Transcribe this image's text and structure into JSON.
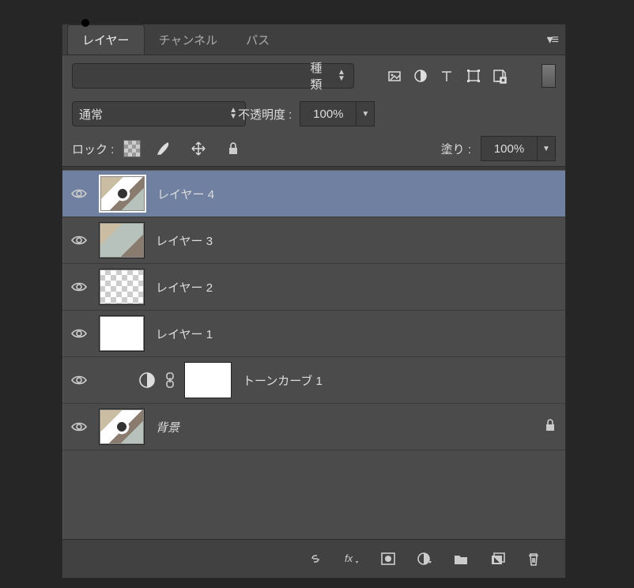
{
  "tabs": {
    "layers": "レイヤー",
    "channels": "チャンネル",
    "paths": "パス"
  },
  "filter": {
    "kind": "種類"
  },
  "blend": {
    "mode": "通常",
    "opacity_label": "不透明度 :",
    "opacity": "100%"
  },
  "lock": {
    "label": "ロック :",
    "fill_label": "塗り :",
    "fill": "100%"
  },
  "layers": [
    {
      "name": "レイヤー 4"
    },
    {
      "name": "レイヤー 3"
    },
    {
      "name": "レイヤー 2"
    },
    {
      "name": "レイヤー 1"
    },
    {
      "name": "トーンカーブ 1"
    },
    {
      "name": "背景"
    }
  ]
}
